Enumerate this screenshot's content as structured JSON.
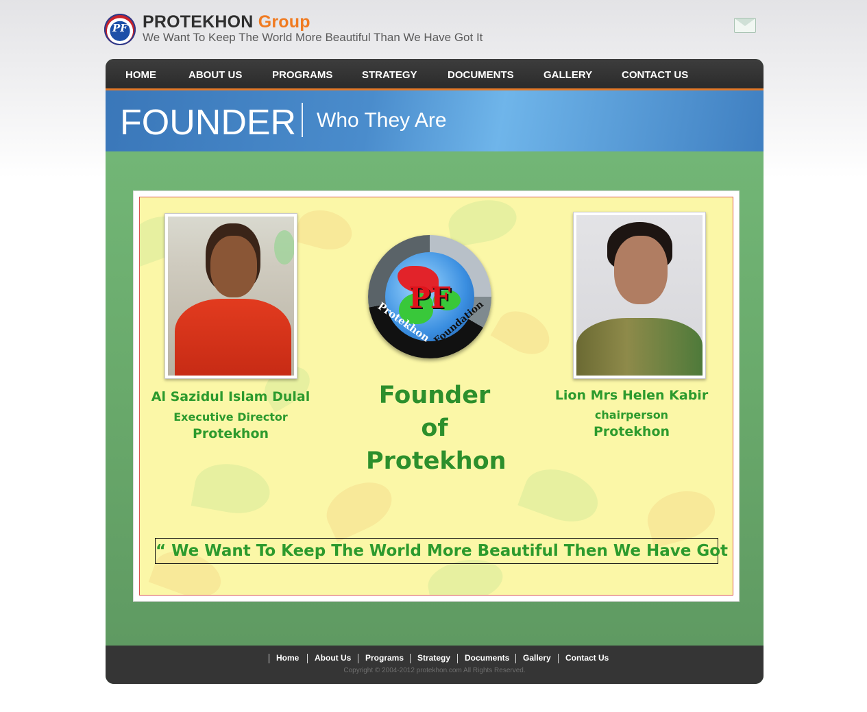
{
  "header": {
    "logo_text": "PF",
    "brand_name": "PROTEKHON",
    "brand_suffix": "Group",
    "tagline": "We Want To Keep The World More Beautiful Than We Have Got It",
    "mail_icon": "mail-icon"
  },
  "nav": {
    "items": [
      {
        "label": "HOME"
      },
      {
        "label": "ABOUT US"
      },
      {
        "label": "PROGRAMS"
      },
      {
        "label": "STRATEGY"
      },
      {
        "label": "DOCUMENTS"
      },
      {
        "label": "GALLERY"
      },
      {
        "label": "CONTACT US"
      }
    ],
    "accent_color": "#e27828"
  },
  "banner": {
    "title": "FOUNDER",
    "subtitle": "Who They Are"
  },
  "poster": {
    "left_person": {
      "name": "Al Sazidul Islam Dulal",
      "role": "Executive Director",
      "org": "Protekhon"
    },
    "right_person": {
      "name": "Lion Mrs Helen Kabir",
      "role": "chairperson",
      "org": "Protekhon"
    },
    "emblem": {
      "initials": "PF",
      "ring_text_left": "Protekhon",
      "ring_text_right": "Foundation"
    },
    "center_lines": [
      "Founder",
      "of",
      "Protekhon"
    ],
    "quote": "“ We Want To Keep The World More Beautiful Then We Have Got  It ”"
  },
  "footer": {
    "links": [
      {
        "label": "Home"
      },
      {
        "label": "About Us"
      },
      {
        "label": "Programs"
      },
      {
        "label": "Strategy"
      },
      {
        "label": "Documents"
      },
      {
        "label": "Gallery"
      },
      {
        "label": "Contact Us"
      }
    ],
    "copyright": "Copyright © 2004-2012 protekhon.com All Rights Reserved."
  },
  "colors": {
    "content_green": "#69a96b",
    "poster_yellow": "#fbf7a7",
    "text_green": "#2c9a2d",
    "banner_blue": "#3a77b9",
    "nav_dark": "#2b2b2b"
  }
}
